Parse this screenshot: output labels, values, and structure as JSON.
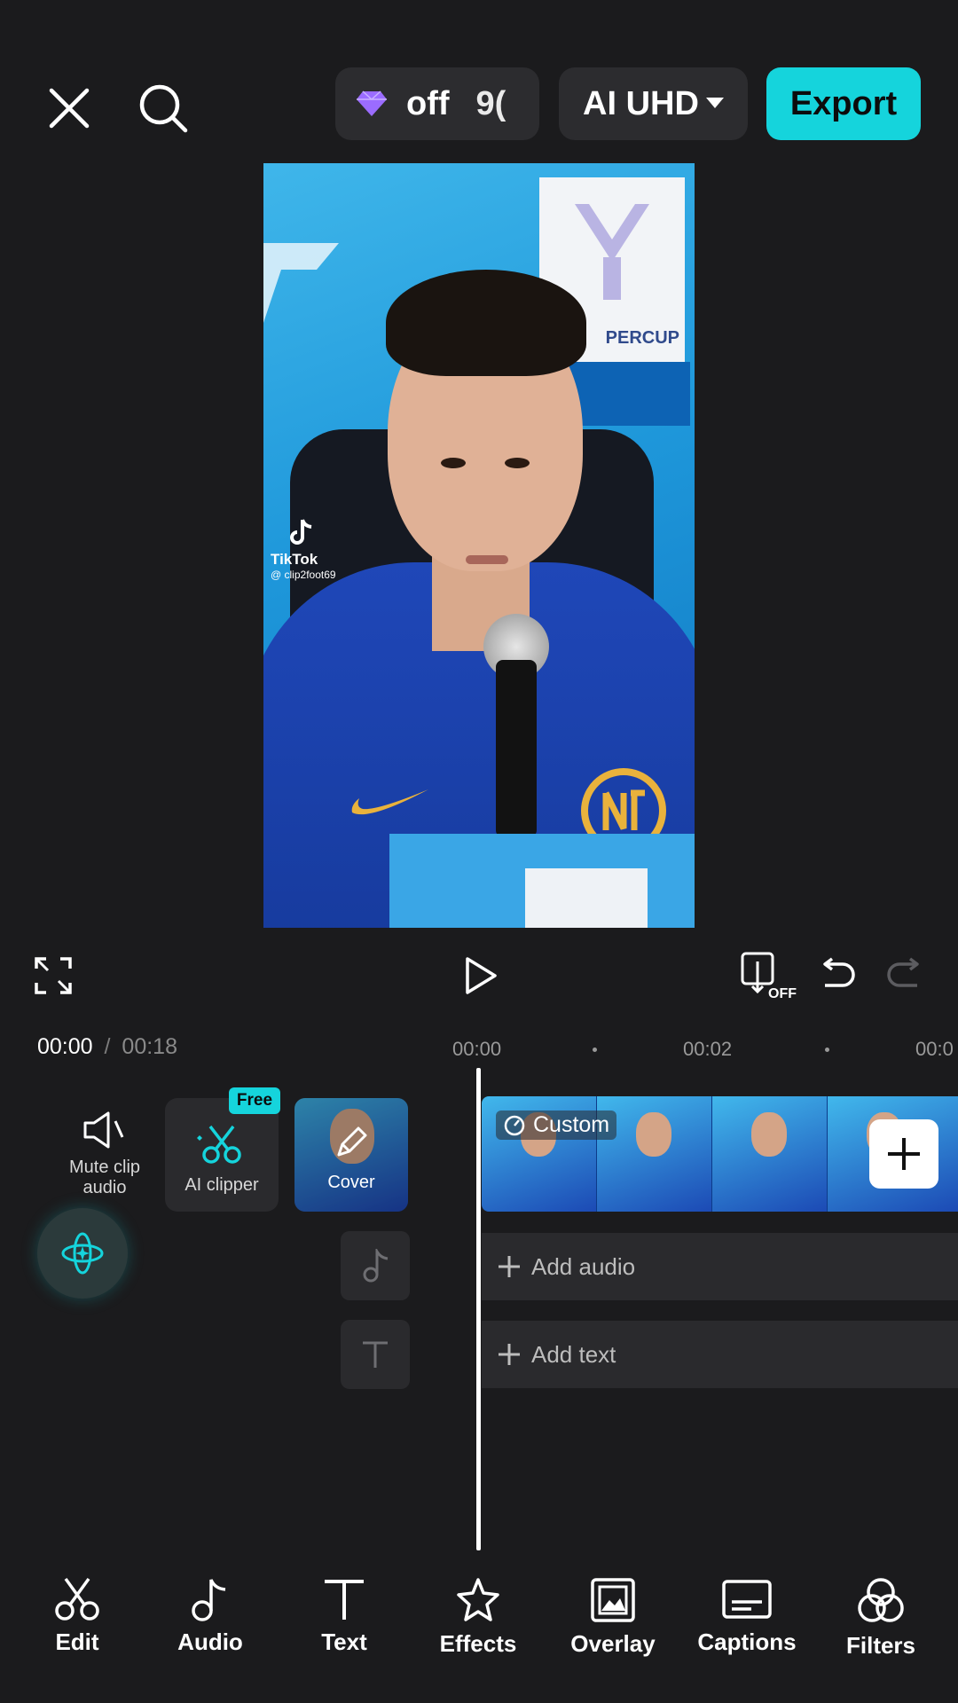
{
  "header": {
    "close_icon": "close-icon",
    "search_icon": "search-icon",
    "pro_badge": {
      "icon": "diamond-icon",
      "label": "off",
      "value": "9("
    },
    "resolution_label": "AI UHD",
    "export_label": "Export",
    "accent_color": "#15d4dc",
    "diamond_color": "#9b6cff"
  },
  "preview": {
    "watermark_brand": "TikTok",
    "watermark_handle": "@ clip2foot69",
    "banner_text": "PERCUP"
  },
  "playback": {
    "fullscreen_icon": "fullscreen-icon",
    "play_icon": "play-icon",
    "keyframe_off_label": "OFF",
    "undo_icon": "undo-icon",
    "redo_icon": "redo-icon"
  },
  "timeline": {
    "current_time": "00:00",
    "separator": "/",
    "total_time": "00:18",
    "ruler": [
      "00:00",
      "00:02",
      "00:0"
    ],
    "mute_label_line1": "Mute clip",
    "mute_label_line2": "audio",
    "ai_clipper_label": "AI clipper",
    "free_badge": "Free",
    "cover_label": "Cover",
    "clip_label": "Custom",
    "add_audio_label": "Add audio",
    "add_text_label": "Add text"
  },
  "toolbar": [
    {
      "label": "Edit",
      "icon": "scissors-icon"
    },
    {
      "label": "Audio",
      "icon": "music-note-icon"
    },
    {
      "label": "Text",
      "icon": "text-icon"
    },
    {
      "label": "Effects",
      "icon": "star-icon"
    },
    {
      "label": "Overlay",
      "icon": "overlay-icon"
    },
    {
      "label": "Captions",
      "icon": "captions-icon"
    },
    {
      "label": "Filters",
      "icon": "filters-icon"
    }
  ]
}
